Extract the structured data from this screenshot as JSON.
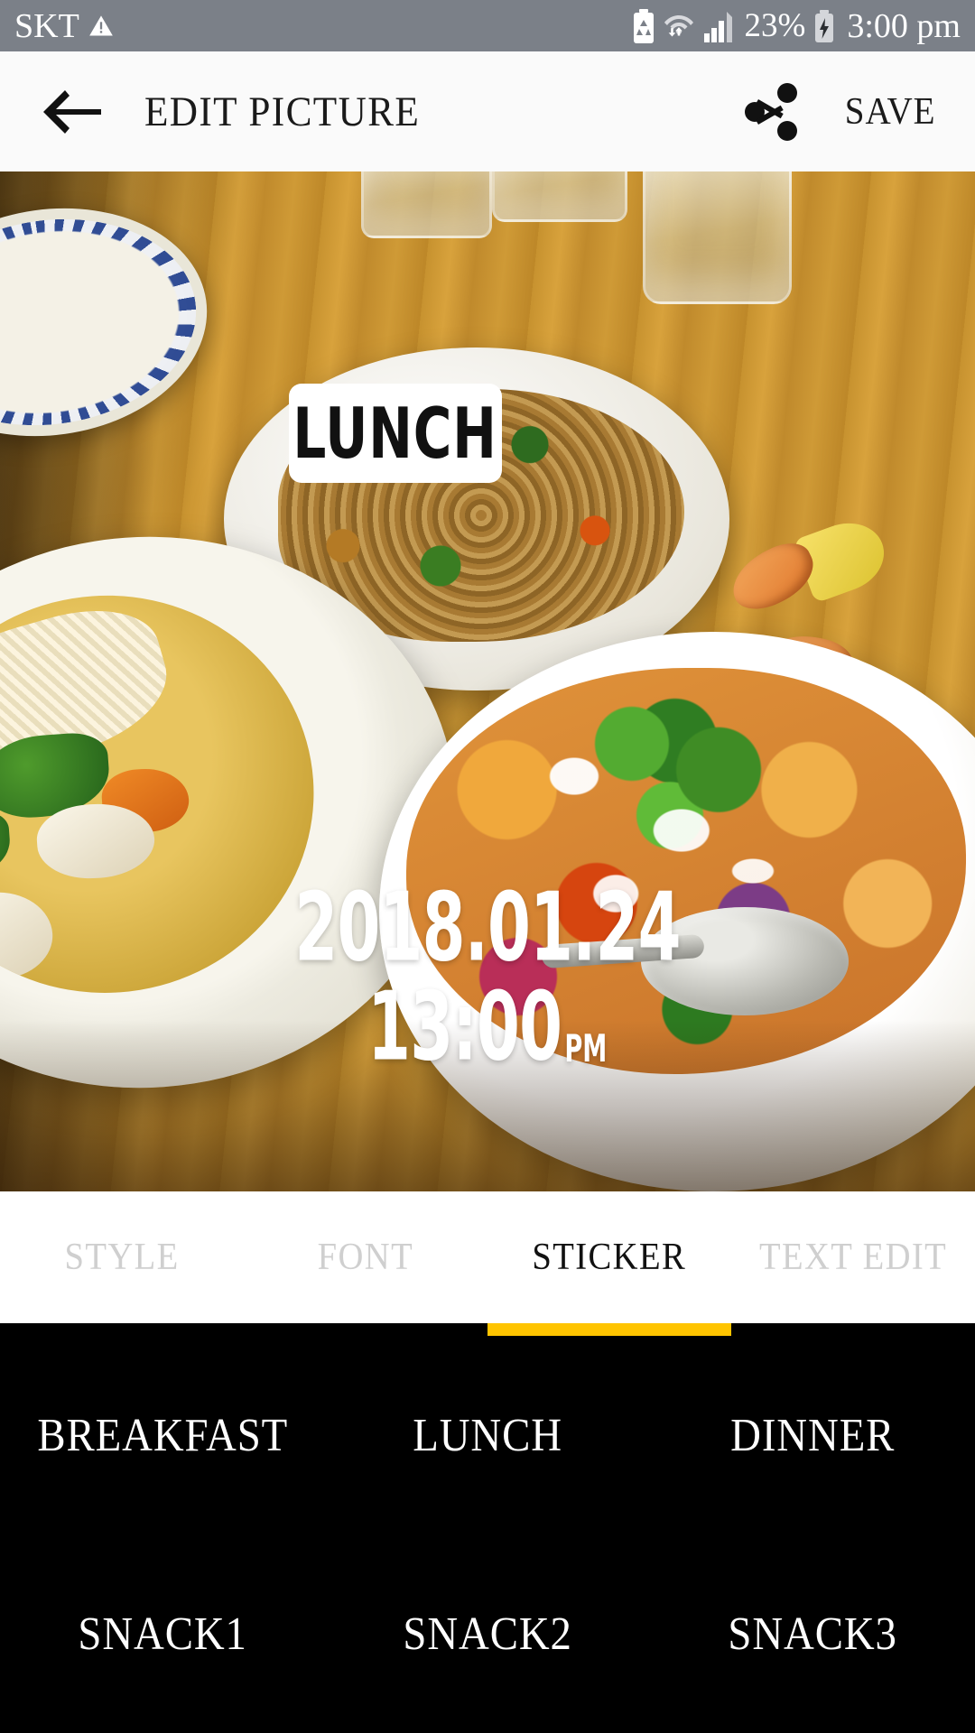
{
  "status_bar": {
    "carrier": "SKT",
    "warning_icon": "warning-triangle-icon",
    "battery_saver_icon": "battery-recycle-icon",
    "wifi_icon": "wifi-transfer-icon",
    "signal_icon": "signal-bars-icon",
    "battery_percent": "23%",
    "charging_icon": "battery-charging-icon",
    "time": "3:00 pm",
    "background_color": "#7b8088"
  },
  "app_bar": {
    "back_icon": "back-arrow-icon",
    "title": "EDIT PICTURE",
    "share_icon": "share-icon",
    "save_label": "SAVE",
    "background_color": "#fafafa"
  },
  "photo": {
    "sticker_overlay": "LUNCH",
    "date_stamp": "2018.01.24",
    "time_stamp": "13:00",
    "am_pm": "PM"
  },
  "tabs": [
    {
      "label": "STYLE",
      "active": false
    },
    {
      "label": "FONT",
      "active": false
    },
    {
      "label": "STICKER",
      "active": true
    },
    {
      "label": "TEXT EDIT",
      "active": false
    }
  ],
  "tab_indicator_color": "#ffc400",
  "sticker_panel": {
    "background_color": "#000000",
    "rows": [
      [
        "BREAKFAST",
        "LUNCH",
        "DINNER"
      ],
      [
        "SNACK1",
        "SNACK2",
        "SNACK3"
      ]
    ]
  }
}
